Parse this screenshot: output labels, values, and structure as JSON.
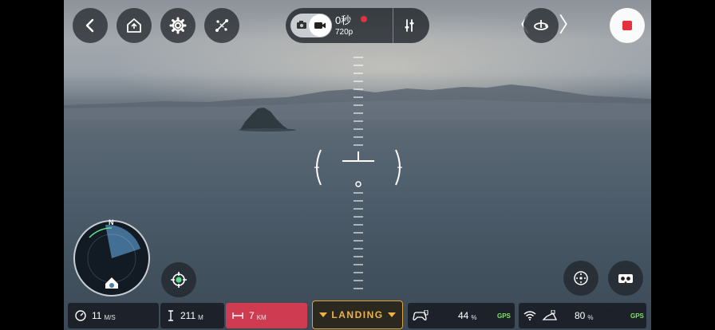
{
  "top_bar": {
    "back_icon": "chevron-left-icon",
    "home_icon": "return-home-icon",
    "settings_icon": "gear-icon",
    "flight_mode_icon": "flight-path-icon"
  },
  "camera": {
    "mode_photo_icon": "camera-icon",
    "mode_video_icon": "video-camera-icon",
    "record_time": "0秒",
    "resolution": "720p",
    "settings_icon": "sliders-icon"
  },
  "gimbal": {
    "left_arrow": "〈",
    "right_arrow": "〉",
    "icon": "rotate-icon"
  },
  "record_button": {
    "icon": "stop-icon",
    "color": "#e5303d"
  },
  "radar": {
    "north_label": "N"
  },
  "status": {
    "speed_value": "11",
    "speed_unit": "M/S",
    "altitude_value": "211",
    "altitude_unit": "M",
    "distance_value": "7",
    "distance_unit": "KM",
    "landing_label": "LANDING",
    "battery_value": "44",
    "battery_unit": "%",
    "battery_gps": "GPS",
    "signal_value": "80",
    "signal_unit": "%",
    "signal_gps": "GPS"
  },
  "colors": {
    "accent_red": "#e5303d",
    "landing_amber": "#f0b247",
    "gps_green": "#7fe25b"
  }
}
